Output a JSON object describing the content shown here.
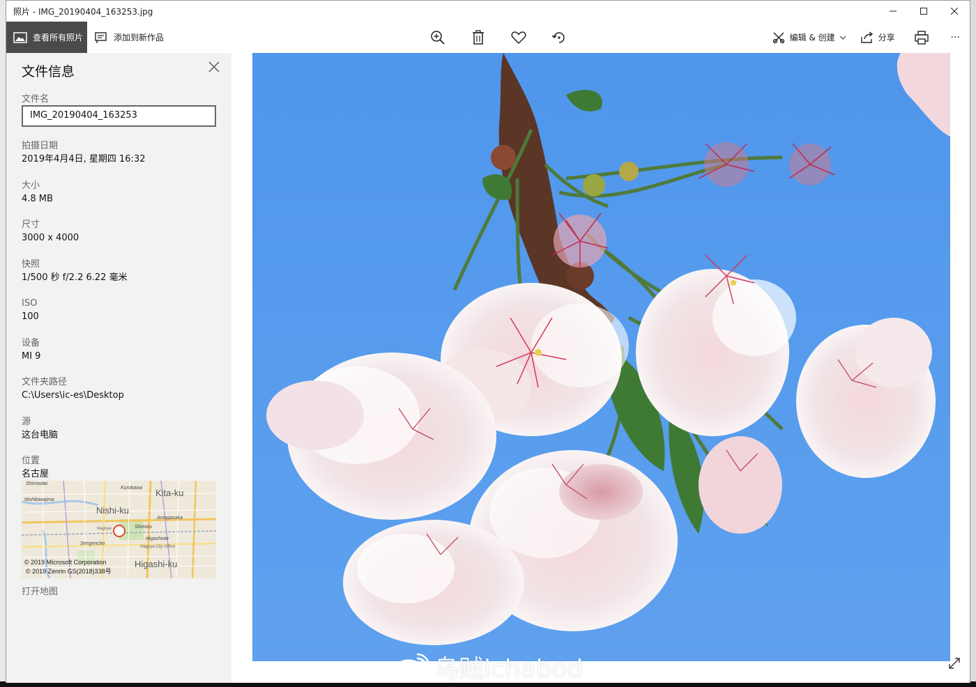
{
  "window": {
    "title": "照片 - IMG_20190404_163253.jpg",
    "minimize": "—",
    "maximize": "☐",
    "close": "✕"
  },
  "toolbar": {
    "view_all_label": "查看所有照片",
    "add_to_creation_label": "添加到新作品",
    "edit_create_label": "编辑 & 创建",
    "share_label": "分享",
    "more_label": "···"
  },
  "info_panel": {
    "title": "文件信息",
    "filename_label": "文件名",
    "filename_value": "IMG_20190404_163253",
    "date_label": "拍摄日期",
    "date_value": "2019年4月4日, 星期四 16:32",
    "size_label": "大小",
    "size_value": "4.8 MB",
    "dimensions_label": "尺寸",
    "dimensions_value": "3000 x 4000",
    "snapshot_label": "快照",
    "snapshot_value": "1/500 秒 f/2.2 6.22 毫米",
    "iso_label": "ISO",
    "iso_value": "100",
    "device_label": "设备",
    "device_value": "MI 9",
    "folder_label": "文件夹路径",
    "folder_value": "C:\\Users\\ic-es\\Desktop",
    "source_label": "源",
    "source_value": "这台电脑",
    "location_label": "位置",
    "location_value": "名古屋",
    "open_map_label": "打开地图"
  },
  "map": {
    "labels": {
      "kita": "Kita-ku",
      "nishi": "Nishi-ku",
      "higashi": "Higashi-ku",
      "kurokawa": "Kurokawa",
      "shimizu": "Shimizu",
      "amagasaka": "Amagasaka",
      "higashiote": "Higashiote",
      "sengencho": "Sengencho",
      "nishibiwajima": "Nishibiwajima",
      "shimootai": "Shimootai",
      "city_office": "Nagoya City Office",
      "nagoya": "Nagoya",
      "copyright_ms": "© 2019 Microsoft Corporation",
      "copyright_zenrin": "© 2019 Zenrin GS(2018)338号"
    }
  },
  "watermark": {
    "text": "乌贼ichabod"
  },
  "colors": {
    "sky": "#5a9bea",
    "panel_bg": "#f2f2f2",
    "active_btn": "#4a4a4a"
  }
}
